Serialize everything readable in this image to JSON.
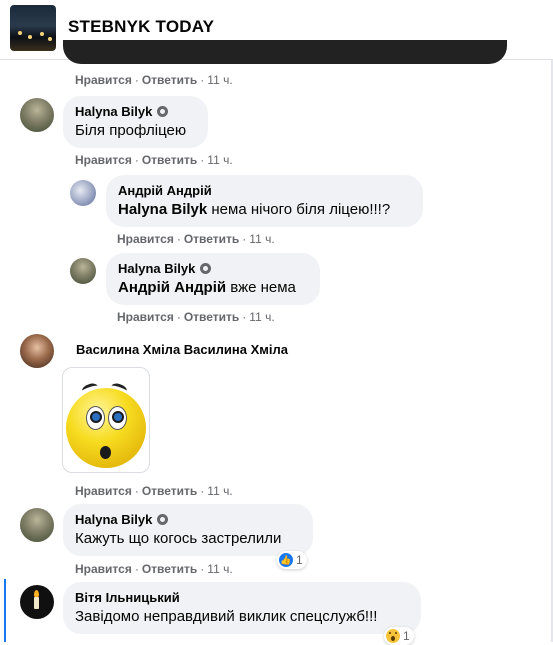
{
  "header": {
    "title": "STEBNYK TODAY"
  },
  "actions": {
    "like": "Нравится",
    "reply": "Ответить",
    "sep": "·"
  },
  "comments": [
    {
      "time": "11 ч."
    },
    {
      "author": "Halyna Bilyk",
      "text": "Біля профліцею",
      "time": "11 ч."
    },
    {
      "author": "Андрій Андрій",
      "mention": "Halyna Bilyk",
      "text": " нема нічого біля ліцею!!!?",
      "time": "11 ч."
    },
    {
      "author": "Halyna Bilyk",
      "mention": "Андрій Андрій",
      "text": " вже нема",
      "time": "11 ч."
    },
    {
      "author": "Василина Хміла Василина Хміла",
      "sticker": "surprised-smiley",
      "time": "11 ч."
    },
    {
      "author": "Halyna Bilyk",
      "text": "Кажуть що когось застрелили",
      "time": "11 ч.",
      "reaction": {
        "icon": "like-icon",
        "count": "1"
      }
    },
    {
      "author": "Вітя Ільницький",
      "text": "Завідомо неправдивий виклик спецслужб!!!",
      "reaction": {
        "icon": "wow-icon",
        "count": "1"
      }
    }
  ]
}
